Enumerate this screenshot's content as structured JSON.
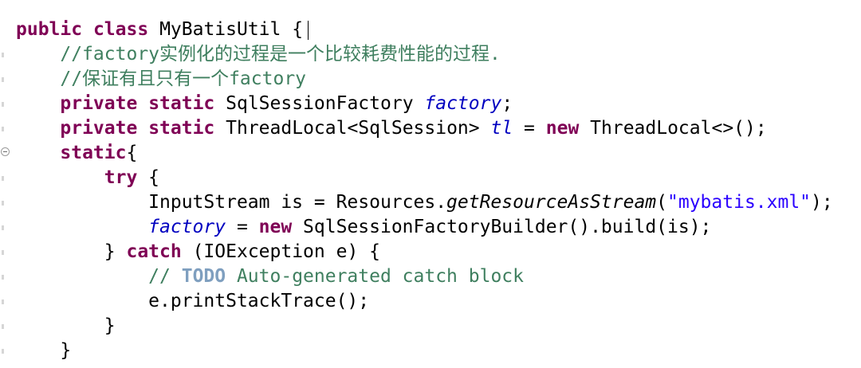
{
  "code": {
    "class_decl": {
      "kw1": "public",
      "kw2": "class",
      "name": "MyBatisUtil",
      "brace": "{"
    },
    "comment1": "//factory实例化的过程是一个比较耗费性能的过程.",
    "comment2": "//保证有且只有一个factory",
    "field1": {
      "kw1": "private",
      "kw2": "static",
      "type": "SqlSessionFactory",
      "name": "factory",
      "end": ";"
    },
    "field2": {
      "kw1": "private",
      "kw2": "static",
      "type": "ThreadLocal<SqlSession>",
      "name": "tl",
      "eq": " = ",
      "kw_new": "new",
      "init": "ThreadLocal<>();"
    },
    "static_block": {
      "kw": "static",
      "brace": "{"
    },
    "try_line": {
      "kw": "try",
      "brace": " {"
    },
    "stream_line": {
      "pre": "InputStream is = Resources.",
      "method": "getResourceAsStream",
      "open": "(",
      "str": "\"mybatis.xml\"",
      "close": ");"
    },
    "factory_line": {
      "field": "factory",
      "eq": " = ",
      "kw_new": "new",
      "rest": " SqlSessionFactoryBuilder().build(is);"
    },
    "catch_line": {
      "pre": "} ",
      "kw": "catch",
      "rest": " (IOException e) {"
    },
    "todo_line": {
      "pre": "// ",
      "todo": "TODO",
      "rest": " Auto-generated catch block"
    },
    "print_line": "e.printStackTrace();",
    "close_try": "}",
    "close_static": "}"
  }
}
